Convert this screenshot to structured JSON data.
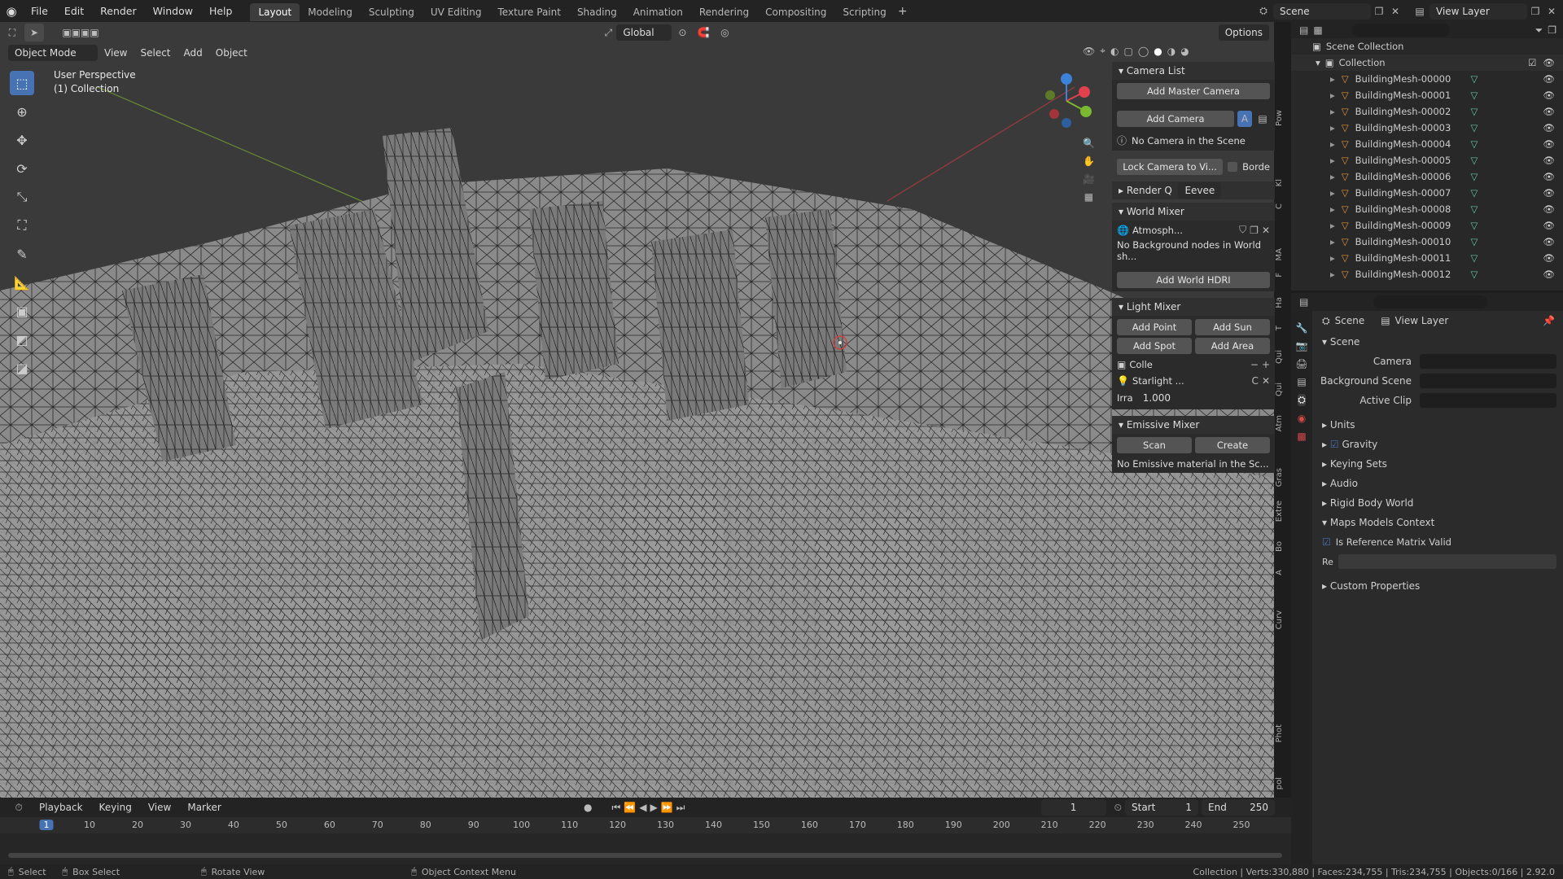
{
  "topbar": {
    "menus": [
      "File",
      "Edit",
      "Render",
      "Window",
      "Help"
    ],
    "workspaces": [
      "Layout",
      "Modeling",
      "Sculpting",
      "UV Editing",
      "Texture Paint",
      "Shading",
      "Animation",
      "Rendering",
      "Compositing",
      "Scripting"
    ],
    "scene_name": "Scene",
    "view_layer": "View Layer"
  },
  "viewport": {
    "mode": "Object Mode",
    "menus": [
      "View",
      "Select",
      "Add",
      "Object"
    ],
    "transform": "Global",
    "options_label": "Options",
    "perspective_label": "User Perspective",
    "collection_label": "(1) Collection"
  },
  "npanel": {
    "camera_list_title": "Camera List",
    "add_master_camera": "Add Master Camera",
    "add_camera": "Add Camera",
    "no_camera_text": "No Camera in the Scene",
    "lock_camera": "Lock Camera to Vi...",
    "border_label": "Borde",
    "render_q_label": "Render Q",
    "render_engine": "Eevee",
    "world_mixer_title": "World Mixer",
    "world_name": "Atmosph...",
    "world_note": "No Background nodes in World sh...",
    "add_world_hdri": "Add World HDRI",
    "light_mixer_title": "Light Mixer",
    "add_point": "Add Point",
    "add_sun": "Add Sun",
    "add_spot": "Add Spot",
    "add_area": "Add Area",
    "collection_short": "Colle",
    "light_name": "Starlight ...",
    "light_c": "C",
    "irra_label": "Irra",
    "irra_value": "1.000",
    "emissive_mixer_title": "Emissive Mixer",
    "scan_label": "Scan",
    "create_label": "Create",
    "emissive_note": "No Emissive material in the Sc..."
  },
  "vertical_tabs": [
    "Pow",
    "Kl",
    "C",
    "MA",
    "F",
    "Ha",
    "T",
    "Qui",
    "Qui",
    "Atm",
    "Gras",
    "Extre",
    "Bo",
    "A",
    "Curv",
    "Phot",
    "pol"
  ],
  "outliner": {
    "scene_collection": "Scene Collection",
    "collection": "Collection",
    "items": [
      "BuildingMesh-00000",
      "BuildingMesh-00001",
      "BuildingMesh-00002",
      "BuildingMesh-00003",
      "BuildingMesh-00004",
      "BuildingMesh-00005",
      "BuildingMesh-00006",
      "BuildingMesh-00007",
      "BuildingMesh-00008",
      "BuildingMesh-00009",
      "BuildingMesh-00010",
      "BuildingMesh-00011",
      "BuildingMesh-00012"
    ]
  },
  "properties": {
    "breadcrumb_scene": "Scene",
    "breadcrumb_view_layer": "View Layer",
    "section_scene": "Scene",
    "camera_label": "Camera",
    "background_scene_label": "Background Scene",
    "active_clip_label": "Active Clip",
    "units": "Units",
    "gravity": "Gravity",
    "keying_sets": "Keying Sets",
    "audio": "Audio",
    "rigid_body_world": "Rigid Body World",
    "maps_models_context": "Maps Models Context",
    "is_reference_matrix_valid": "Is Reference Matrix Valid",
    "re_label": "Re",
    "custom_properties": "Custom Properties"
  },
  "timeline": {
    "menus": [
      "Playback",
      "Keying",
      "View",
      "Marker"
    ],
    "current_frame": "1",
    "start_label": "Start",
    "start_value": "1",
    "end_label": "End",
    "end_value": "250",
    "ruler": [
      "1",
      "10",
      "20",
      "30",
      "40",
      "50",
      "60",
      "70",
      "80",
      "90",
      "100",
      "110",
      "120",
      "130",
      "140",
      "150",
      "160",
      "170",
      "180",
      "190",
      "200",
      "210",
      "220",
      "230",
      "240",
      "250"
    ]
  },
  "status": {
    "select": "Select",
    "box_select": "Box Select",
    "rotate_view": "Rotate View",
    "object_context_menu": "Object Context Menu",
    "stats": "Collection | Verts:330,880 | Faces:234,755 | Tris:234,755 | Objects:0/166 | 2.92.0"
  },
  "colors": {
    "accent_blue": "#4772b3",
    "mesh_orange": "#e69138",
    "mesh_data_green": "#5fc4a0",
    "axis_red": "#e0414d",
    "axis_green": "#7ab82f",
    "axis_blue": "#3c82d8"
  }
}
